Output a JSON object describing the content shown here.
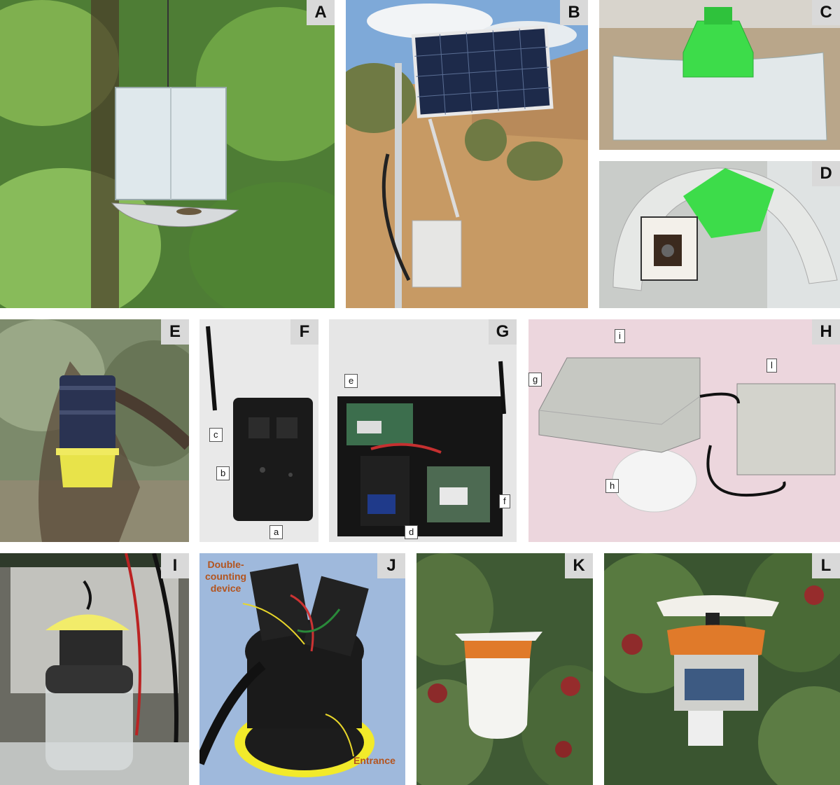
{
  "panels": {
    "A": {
      "label": "A"
    },
    "B": {
      "label": "B"
    },
    "C": {
      "label": "C"
    },
    "D": {
      "label": "D"
    },
    "E": {
      "label": "E"
    },
    "F": {
      "label": "F",
      "callouts": {
        "a": "a",
        "b": "b",
        "c": "c"
      }
    },
    "G": {
      "label": "G",
      "callouts": {
        "d": "d",
        "e": "e",
        "f": "f"
      }
    },
    "H": {
      "label": "H",
      "callouts": {
        "g": "g",
        "h": "h",
        "i": "i",
        "l": "l"
      }
    },
    "I": {
      "label": "I"
    },
    "J": {
      "label": "J",
      "annotations": {
        "device": "Double-\ncounting\ndevice",
        "entrance": "Entrance"
      }
    },
    "K": {
      "label": "K"
    },
    "L": {
      "label": "L"
    }
  },
  "colors": {
    "label_bg": "#d9d9d9",
    "annotation": "#b3541e",
    "trap_green": "#3ddc4a",
    "trap_yellow": "#e8e34a",
    "trap_orange": "#e07a2a"
  }
}
